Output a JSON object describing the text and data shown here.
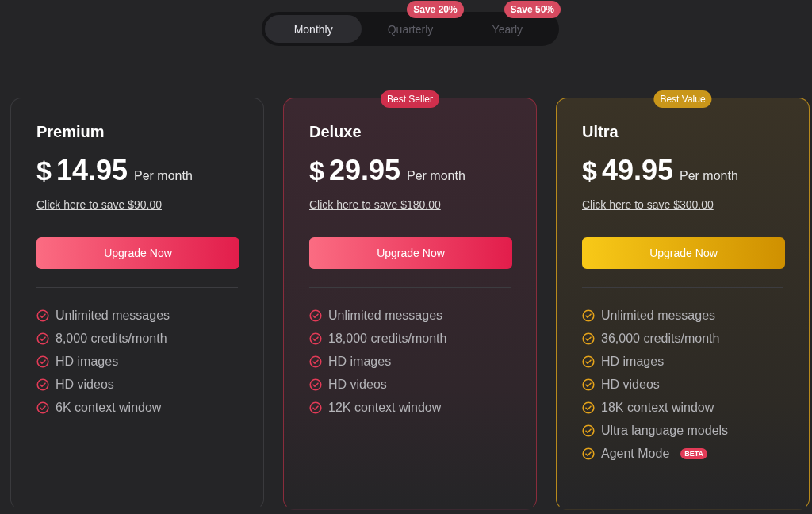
{
  "billing_tabs": [
    {
      "label": "Monthly",
      "selected": true
    },
    {
      "label": "Quarterly",
      "selected": false,
      "badge": "Save 20%"
    },
    {
      "label": "Yearly",
      "selected": false,
      "badge": "Save 50%"
    }
  ],
  "plans": [
    {
      "kind": "plain",
      "name": "Premium",
      "currency": "$",
      "price": "14.95",
      "period": "Per month",
      "save_link": "Click here to save $90.00",
      "button": "Upgrade Now",
      "features": [
        {
          "text": "Unlimited messages"
        },
        {
          "text": "8,000 credits/month"
        },
        {
          "text": "HD images"
        },
        {
          "text": "HD videos"
        },
        {
          "text": "6K context window"
        }
      ]
    },
    {
      "kind": "red",
      "badge": "Best Seller",
      "name": "Deluxe",
      "currency": "$",
      "price": "29.95",
      "period": "Per month",
      "save_link": "Click here to save $180.00",
      "button": "Upgrade Now",
      "features": [
        {
          "text": "Unlimited messages"
        },
        {
          "text": "18,000 credits/month"
        },
        {
          "text": "HD images"
        },
        {
          "text": "HD videos"
        },
        {
          "text": "12K context window"
        }
      ]
    },
    {
      "kind": "gold",
      "badge": "Best Value",
      "name": "Ultra",
      "currency": "$",
      "price": "49.95",
      "period": "Per month",
      "save_link": "Click here to save $300.00",
      "button": "Upgrade Now",
      "features": [
        {
          "text": "Unlimited messages"
        },
        {
          "text": "36,000 credits/month"
        },
        {
          "text": "HD images"
        },
        {
          "text": "HD videos"
        },
        {
          "text": "18K context window"
        },
        {
          "text": "Ultra language models"
        },
        {
          "text": "Agent Mode",
          "badge": "BETA"
        }
      ]
    }
  ]
}
